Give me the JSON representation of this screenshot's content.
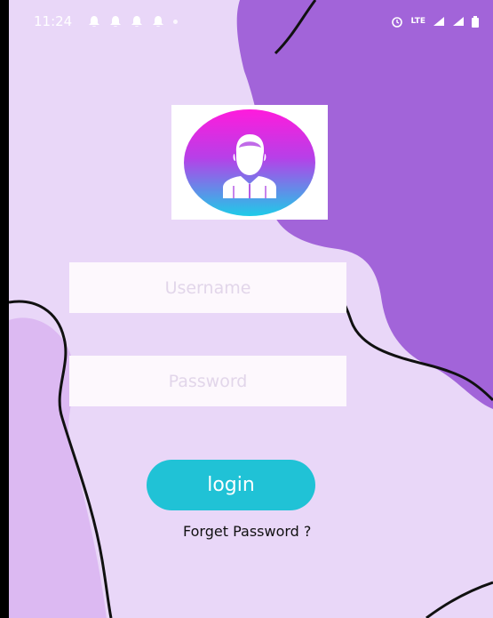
{
  "status_bar": {
    "time": "11:24",
    "network": "LTE"
  },
  "form": {
    "username_placeholder": "Username",
    "password_placeholder": "Password",
    "login_label": "login",
    "forget_password_label": "Forget Password ?"
  },
  "colors": {
    "background": "#e9d7f8",
    "blob_dark": "#a264d9",
    "blob_light": "#dcb9f2",
    "button": "#20c2d6",
    "avatar_gradient_top": "#ff1bdc",
    "avatar_gradient_bottom": "#1ecbe8"
  },
  "icons": {
    "avatar": "user-avatar-icon",
    "notifications": "bell-icon",
    "alarm": "alarm-icon",
    "signal": "signal-icon",
    "battery": "battery-icon"
  }
}
